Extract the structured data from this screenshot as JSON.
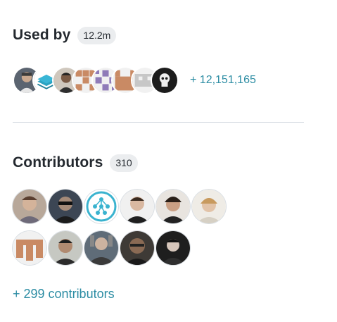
{
  "used_by": {
    "title": "Used by",
    "count": "12.2m",
    "more_label": "+ 12,151,165",
    "avatars": [
      {
        "icon": "user-avatar-1"
      },
      {
        "icon": "stack-logo-avatar"
      },
      {
        "icon": "user-avatar-2"
      },
      {
        "icon": "identicon-tan-avatar"
      },
      {
        "icon": "identicon-purple-avatar"
      },
      {
        "icon": "identicon-tan-avatar-2"
      },
      {
        "icon": "identicon-gray-avatar"
      },
      {
        "icon": "skull-avatar"
      }
    ]
  },
  "contributors": {
    "title": "Contributors",
    "count": "310",
    "more_label": "+ 299 contributors",
    "avatars": [
      {
        "icon": "contributor-avatar-1"
      },
      {
        "icon": "contributor-avatar-2"
      },
      {
        "icon": "network-logo-avatar"
      },
      {
        "icon": "contributor-avatar-4"
      },
      {
        "icon": "contributor-avatar-5"
      },
      {
        "icon": "contributor-avatar-6"
      },
      {
        "icon": "identicon-tan-contributor-avatar"
      },
      {
        "icon": "contributor-avatar-8"
      },
      {
        "icon": "contributor-avatar-9"
      },
      {
        "icon": "contributor-avatar-10"
      },
      {
        "icon": "contributor-avatar-11"
      }
    ]
  },
  "colors": {
    "link": "#2b8ca3",
    "counter_bg": "#ebedef",
    "divider": "#d0d7de",
    "text": "#24292f"
  }
}
